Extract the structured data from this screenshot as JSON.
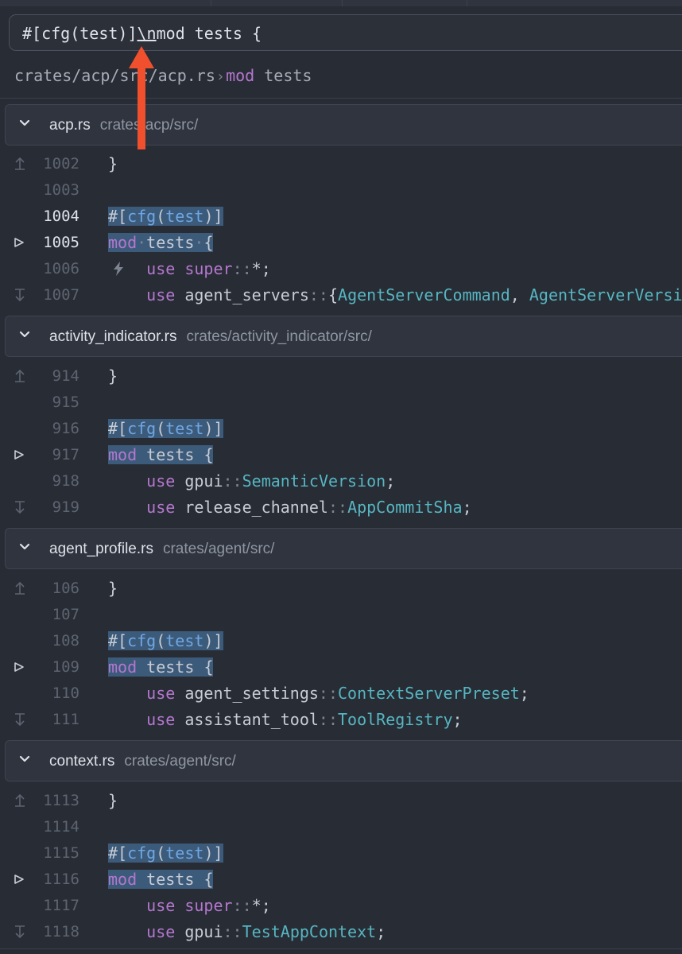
{
  "search": {
    "before": "#[cfg(test)]",
    "escape": "\\n",
    "after": "mod tests {"
  },
  "breadcrumb": {
    "path": "crates/acp/src/acp.rs",
    "separator": "›",
    "symbol_keyword": "mod",
    "symbol_name": "tests"
  },
  "excerpts": [
    {
      "file": "acp.rs",
      "path": "crates/acp/src/",
      "lines": {
        "l1": {
          "num": "1002",
          "brace": "}"
        },
        "l2": {
          "num": "1003"
        },
        "l3": {
          "num": "1004",
          "hash": "#[",
          "attr": "cfg",
          "open": "(",
          "arg": "test",
          "close": ")]"
        },
        "l4": {
          "num": "1005",
          "kw": "mod",
          "name": "tests",
          "brace": "{"
        },
        "l5": {
          "num": "1006",
          "kw": "use",
          "path": "super",
          "colons": "::",
          "rest": "*;"
        },
        "l6": {
          "num": "1007",
          "kw": "use",
          "path": "agent_servers",
          "colons": "::",
          "brace": "{",
          "t1": "AgentServerCommand",
          "comma": ",",
          "t2": "AgentServerVersi"
        }
      }
    },
    {
      "file": "activity_indicator.rs",
      "path": "crates/activity_indicator/src/",
      "lines": {
        "l1": {
          "num": "914",
          "brace": "}"
        },
        "l2": {
          "num": "915"
        },
        "l3": {
          "num": "916",
          "hash": "#[",
          "attr": "cfg",
          "open": "(",
          "arg": "test",
          "close": ")]"
        },
        "l4": {
          "num": "917",
          "kw": "mod",
          "name": "tests",
          "brace": "{"
        },
        "l5": {
          "num": "918",
          "kw": "use",
          "path": "gpui",
          "colons": "::",
          "type": "SemanticVersion",
          "semi": ";"
        },
        "l6": {
          "num": "919",
          "kw": "use",
          "path": "release_channel",
          "colons": "::",
          "type": "AppCommitSha",
          "semi": ";"
        }
      }
    },
    {
      "file": "agent_profile.rs",
      "path": "crates/agent/src/",
      "lines": {
        "l1": {
          "num": "106",
          "brace": "}"
        },
        "l2": {
          "num": "107"
        },
        "l3": {
          "num": "108",
          "hash": "#[",
          "attr": "cfg",
          "open": "(",
          "arg": "test",
          "close": ")]"
        },
        "l4": {
          "num": "109",
          "kw": "mod",
          "name": "tests",
          "brace": "{"
        },
        "l5": {
          "num": "110",
          "kw": "use",
          "path": "agent_settings",
          "colons": "::",
          "type": "ContextServerPreset",
          "semi": ";"
        },
        "l6": {
          "num": "111",
          "kw": "use",
          "path": "assistant_tool",
          "colons": "::",
          "type": "ToolRegistry",
          "semi": ";"
        }
      }
    },
    {
      "file": "context.rs",
      "path": "crates/agent/src/",
      "lines": {
        "l1": {
          "num": "1113",
          "brace": "}"
        },
        "l2": {
          "num": "1114"
        },
        "l3": {
          "num": "1115",
          "hash": "#[",
          "attr": "cfg",
          "open": "(",
          "arg": "test",
          "close": ")]"
        },
        "l4": {
          "num": "1116",
          "kw": "mod",
          "name": "tests",
          "brace": "{"
        },
        "l5": {
          "num": "1117",
          "kw": "use",
          "path": "super",
          "colons": "::",
          "rest": "*;"
        },
        "l6": {
          "num": "1118",
          "kw": "use",
          "path": "gpui",
          "colons": "::",
          "type": "TestAppContext",
          "semi": ";"
        }
      }
    }
  ],
  "colors": {
    "background": "#282c34",
    "keyword": "#b477cf",
    "type": "#56b6c2",
    "selection": "#3c5a7a",
    "annotation_arrow": "#f0502d"
  }
}
